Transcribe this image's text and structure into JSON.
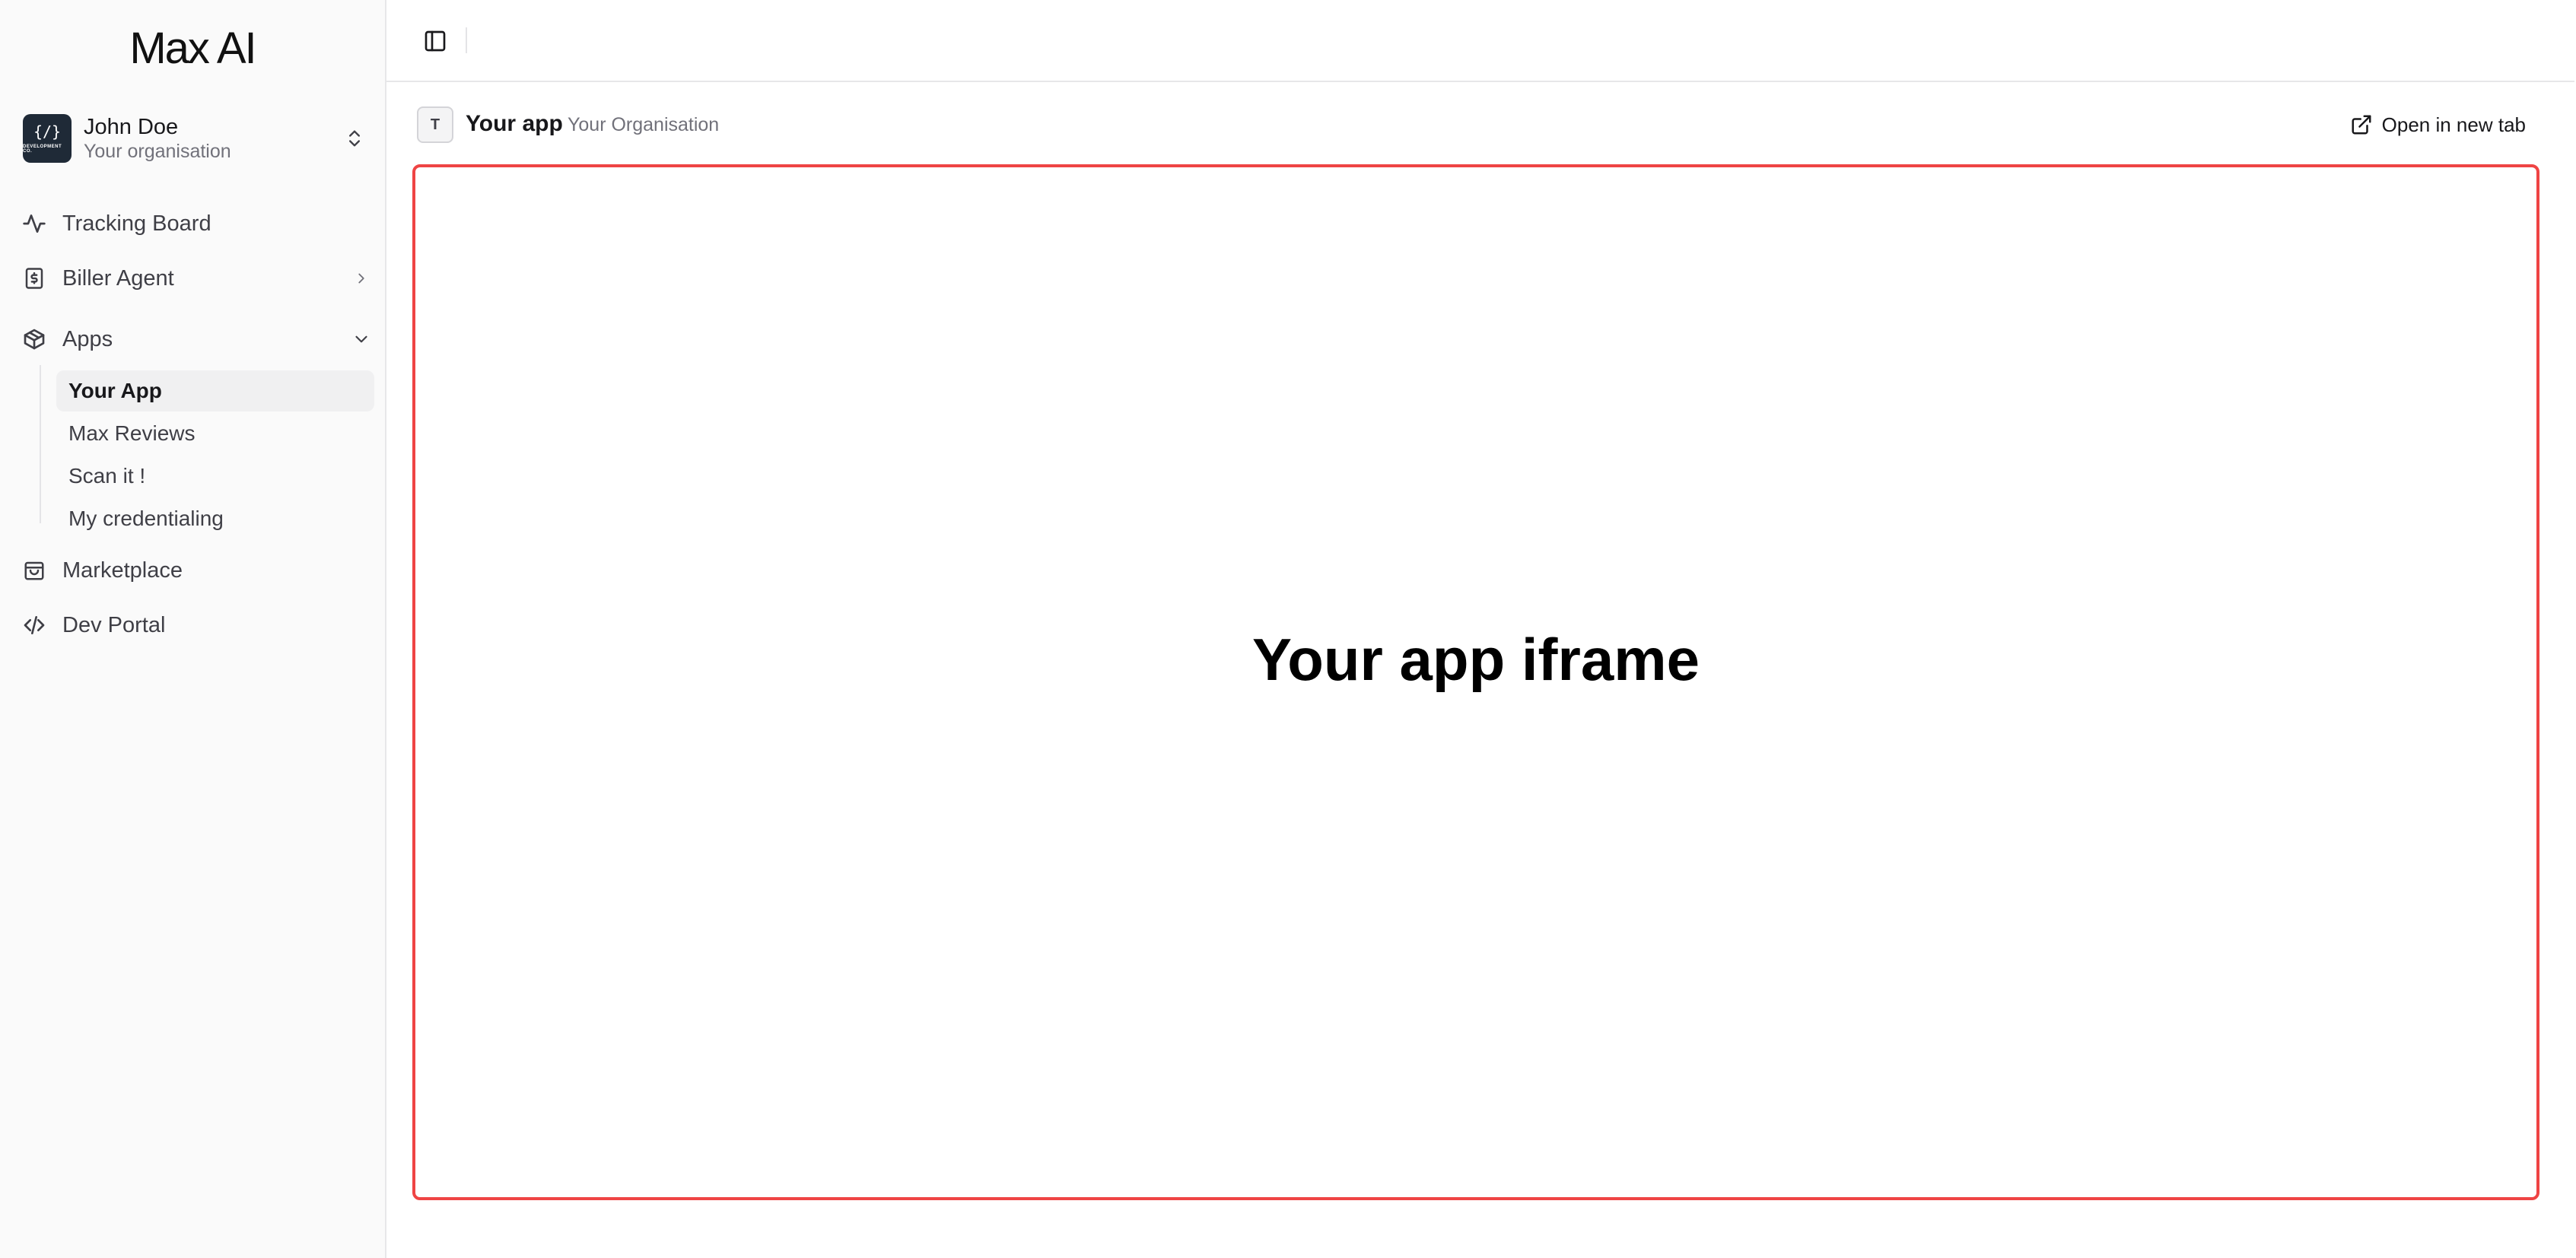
{
  "sidebar": {
    "logo": "Max AI",
    "org_switcher": {
      "name": "John Doe",
      "subtitle": "Your organisation",
      "avatar_code": "{/}",
      "avatar_caption": "DEVELOPMENT CO."
    },
    "nav": {
      "tracking_board": "Tracking Board",
      "biller_agent": "Biller Agent",
      "apps": "Apps",
      "marketplace": "Marketplace",
      "dev_portal": "Dev Portal"
    },
    "apps_children": [
      "Your App",
      "Max Reviews",
      "Scan it !",
      "My credentialing"
    ],
    "active_app": "Your App"
  },
  "header": {
    "app_badge": "T",
    "app_title": "Your app",
    "app_org": "Your Organisation",
    "open_new_tab": "Open in new tab"
  },
  "content": {
    "iframe_placeholder": "Your app iframe",
    "iframe_border_color": "#ef4444"
  },
  "icons": {
    "sidebar_toggle": "panel-left-icon",
    "tracking_board": "activity-icon",
    "biller_agent": "receipt-dollar-icon",
    "apps": "package-icon",
    "marketplace": "shopping-bag-icon",
    "dev_portal": "code-icon",
    "open_new_tab": "external-link-icon"
  }
}
